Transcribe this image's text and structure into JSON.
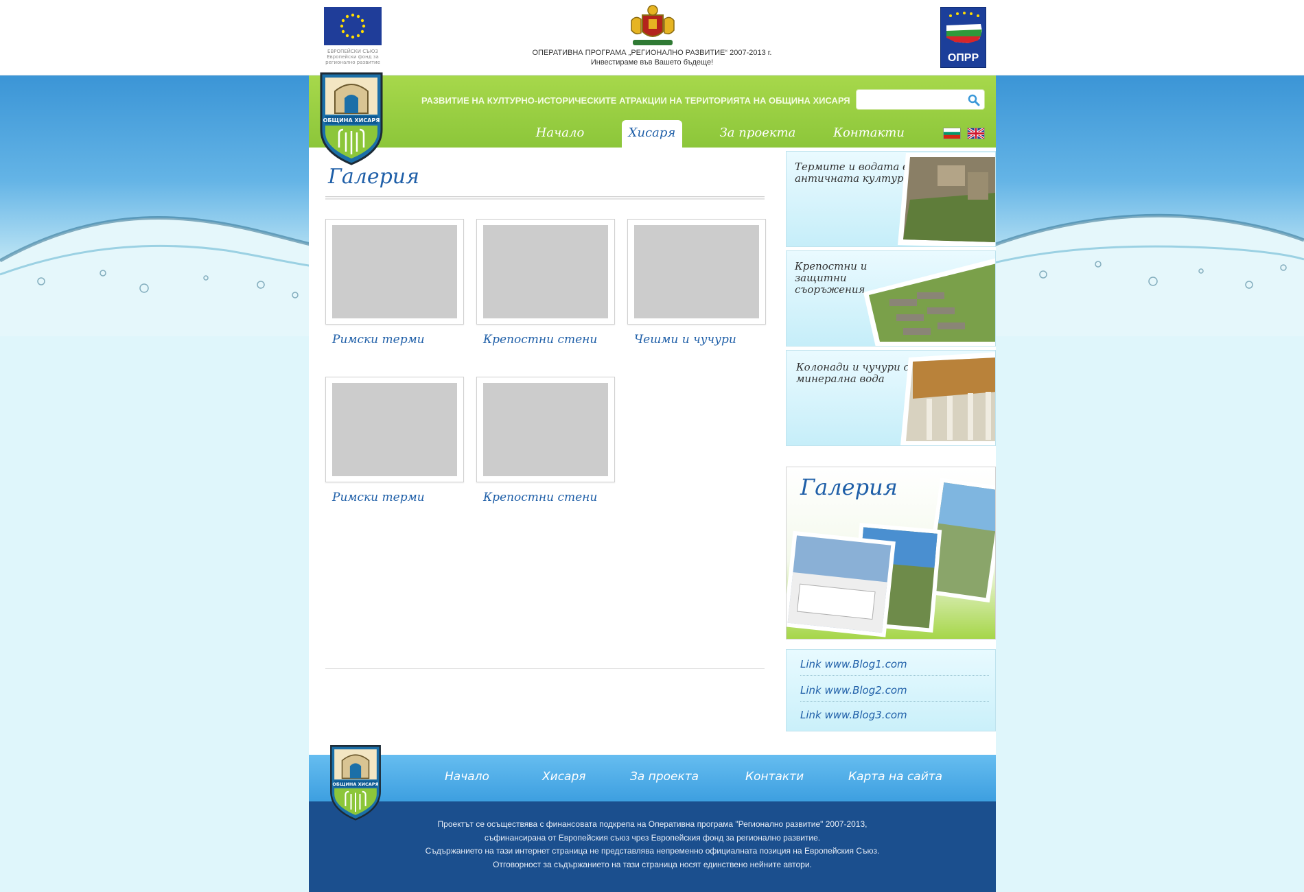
{
  "top": {
    "eu_caption": "ЕВРОПЕЙСКИ СЪЮЗ\nЕвропейски фонд за\nрегионално развитие",
    "program_line1": "ОПЕРАТИВНА ПРОГРАМА „РЕГИОНАЛНО РАЗВИТИЕ“ 2007-2013 г.",
    "program_line2": "Инвестираме във Вашето бъдеще!",
    "opr_label": "ОПРР"
  },
  "header": {
    "tagline": "РАЗВИТИЕ НА КУЛТУРНО-ИСТОРИЧЕСКИТЕ АТРАКЦИИ НА ТЕРИТОРИЯТА НА ОБЩИНА ХИСАРЯ",
    "search": {
      "value": "",
      "placeholder": ""
    },
    "crest_label": "ОБЩИНА ХИСАРЯ",
    "nav": [
      {
        "label": "Начало",
        "active": false
      },
      {
        "label": "Хисаря",
        "active": true
      },
      {
        "label": "За проекта",
        "active": false
      },
      {
        "label": "Контакти",
        "active": false
      }
    ]
  },
  "content": {
    "title": "Галерия",
    "items": [
      {
        "caption": "Римски терми"
      },
      {
        "caption": "Крепостни стени"
      },
      {
        "caption": "Чешми и чучури"
      },
      {
        "caption": "Римски терми"
      },
      {
        "caption": "Крепостни стени"
      }
    ]
  },
  "sidebar": {
    "promos": [
      {
        "text": "Термите и водата в античната култура"
      },
      {
        "text": "Крепостни и защитни съоръжения"
      },
      {
        "text": "Колонади и чучури с минерална вода"
      }
    ],
    "gallery_title": "Галерия",
    "links": [
      {
        "label": "Link www.Blog1.com"
      },
      {
        "label": "Link www.Blog2.com"
      },
      {
        "label": "Link www.Blog3.com"
      }
    ]
  },
  "footer": {
    "nav": [
      {
        "label": "Начало"
      },
      {
        "label": "Хисаря"
      },
      {
        "label": "За проекта"
      },
      {
        "label": "Контакти"
      },
      {
        "label": "Карта на сайта"
      }
    ],
    "lines": [
      "Проектът се осъществява с финансовата подкрепа на Оперативна програма \"Регионално развитие\" 2007-2013,",
      "съфинансирана от Европейския съюз чрез Европейския фонд за регионално развитие.",
      "Съдържанието на тази интернет страница не представлява непременно официалната позиция на Европейския Съюз.",
      "Отговорност за съдържанието на тази страница носят единствено нейните автори."
    ]
  },
  "colors": {
    "brand_green": "#8cc63a",
    "brand_blue": "#1f5fa8",
    "footer_blue": "#1b4f8e",
    "sky_blue": "#3b95d6"
  }
}
